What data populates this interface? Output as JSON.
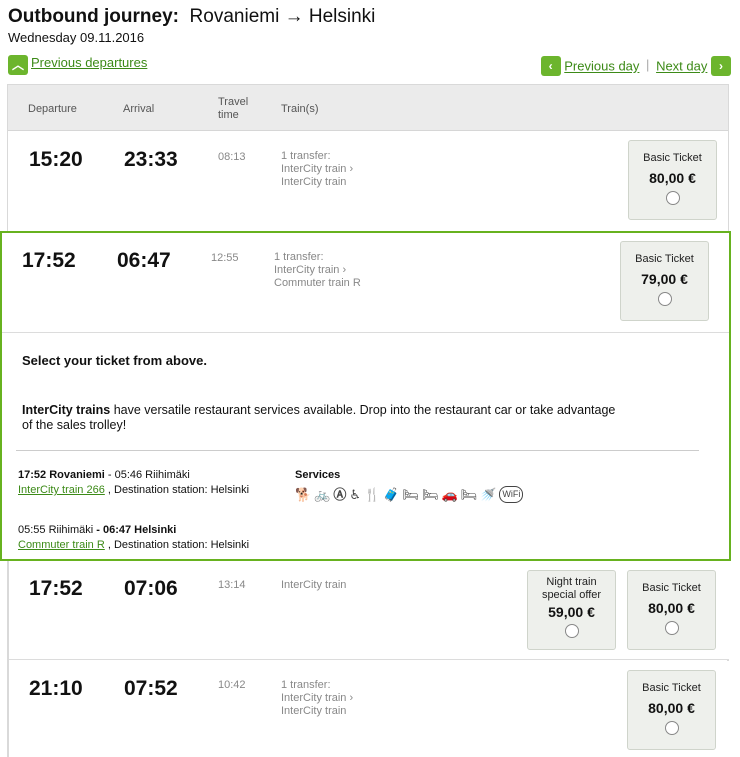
{
  "header": {
    "title_bold": "Outbound journey:",
    "title_route": "Rovaniemi → Helsinki",
    "date": "Wednesday 09.11.2016"
  },
  "nav": {
    "previous_departures": "Previous departures",
    "previous_day": "Previous day",
    "separator": "|",
    "next_day": "Next day",
    "up_icon": "chevron-up-icon",
    "left_icon": "chevron-left-icon",
    "right_icon": "chevron-right-icon"
  },
  "columns": {
    "departure": "Departure",
    "arrival": "Arrival",
    "travel_line1": "Travel",
    "travel_line2": "time",
    "trains": "Train(s)"
  },
  "rows": [
    {
      "dep": "15:20",
      "arr": "23:33",
      "dur": "08:13",
      "trains": [
        "1 transfer:",
        "InterCity train ›",
        "InterCity train"
      ],
      "tickets": [
        {
          "label": "Basic Ticket",
          "price": "80,00 €"
        }
      ]
    },
    {
      "dep": "17:52",
      "arr": "06:47",
      "dur": "12:55",
      "trains": [
        "1 transfer:",
        "InterCity train ›",
        "Commuter train R"
      ],
      "tickets": [
        {
          "label": "Basic Ticket",
          "price": "79,00 €"
        }
      ]
    },
    {
      "dep": "17:52",
      "arr": "07:06",
      "dur": "13:14",
      "trains": [
        "InterCity train"
      ],
      "tickets": [
        {
          "label1": "Night train",
          "label2": "special offer",
          "price": "59,00 €"
        },
        {
          "label": "Basic Ticket",
          "price": "80,00 €"
        }
      ]
    },
    {
      "dep": "21:10",
      "arr": "07:52",
      "dur": "10:42",
      "trains": [
        "1 transfer:",
        "InterCity train ›",
        "InterCity train"
      ],
      "tickets": [
        {
          "label": "Basic Ticket",
          "price": "80,00 €"
        }
      ]
    }
  ],
  "details": {
    "select_prompt": "Select your ticket from above.",
    "intercity_bold": "InterCity trains",
    "intercity_text_1": " have versatile restaurant services available. Drop into the restaurant car or take advantage",
    "intercity_text_2": "of the sales trolley!",
    "leg1_bold": "17:52 Rovaniemi",
    "leg1_rest": " - 05:46 Riihimäki",
    "leg1_link": "InterCity train 266",
    "leg1_dest": " , Destination station: Helsinki",
    "services_label": "Services",
    "services_icons": [
      "dog-icon",
      "bicycle-icon",
      "accessibility-a-icon",
      "wheelchair-icon",
      "restaurant-icon",
      "luggage-icon",
      "bed-icon",
      "bed-icon",
      "car-transport-icon",
      "bed-icon",
      "shower-icon",
      "wifi-icon"
    ],
    "leg2_start": "05:55 Riihimäki",
    "leg2_bold": " - 06:47 Helsinki",
    "leg2_link": "Commuter train R",
    "leg2_dest": " , Destination station: Helsinki"
  },
  "colors": {
    "accent": "#67b21f",
    "link": "#3c8a17"
  }
}
